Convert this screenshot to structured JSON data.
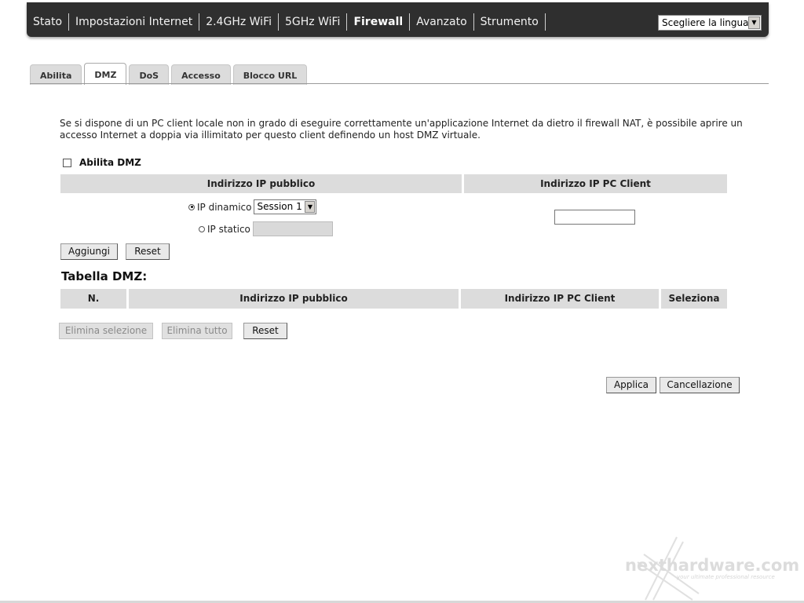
{
  "nav": {
    "items": [
      {
        "label": "Stato",
        "active": false
      },
      {
        "label": "Impostazioni Internet",
        "active": false
      },
      {
        "label": "2.4GHz WiFi",
        "active": false
      },
      {
        "label": "5GHz WiFi",
        "active": false
      },
      {
        "label": "Firewall",
        "active": true
      },
      {
        "label": "Avanzato",
        "active": false
      },
      {
        "label": "Strumento",
        "active": false
      }
    ],
    "language_select": "Scegliere la lingua"
  },
  "tabs": [
    {
      "label": "Abilita",
      "active": false
    },
    {
      "label": "DMZ",
      "active": true
    },
    {
      "label": "DoS",
      "active": false
    },
    {
      "label": "Accesso",
      "active": false
    },
    {
      "label": "Blocco URL",
      "active": false
    }
  ],
  "description": "Se si dispone di un PC client locale non in grado di eseguire correttamente un'applicazione Internet da dietro il firewall NAT, è possibile aprire un accesso Internet a doppia via illimitato per questo client definendo un host DMZ virtuale.",
  "enable_dmz": {
    "label": "Abilita DMZ",
    "checked": false
  },
  "config_table": {
    "col_public_ip": "Indirizzo IP pubblico",
    "col_client_ip": "Indirizzo IP PC Client",
    "dynamic_ip_label": "IP dinamico",
    "dynamic_ip_selected": true,
    "session_select": "Session 1",
    "static_ip_label": "IP statico",
    "static_ip_value": "",
    "client_ip_value": ""
  },
  "buttons": {
    "add": "Aggiungi",
    "reset": "Reset",
    "delete_selected": "Elimina selezione",
    "delete_all": "Elimina tutto",
    "reset2": "Reset",
    "apply": "Applica",
    "cancel": "Cancellazione"
  },
  "dmz_table": {
    "title": "Tabella DMZ:",
    "headers": [
      "N.",
      "Indirizzo IP pubblico",
      "Indirizzo IP PC Client",
      "Seleziona"
    ],
    "rows": []
  },
  "watermark": {
    "text": "nexthardware.com",
    "tagline": "your ultimate professional resource"
  }
}
